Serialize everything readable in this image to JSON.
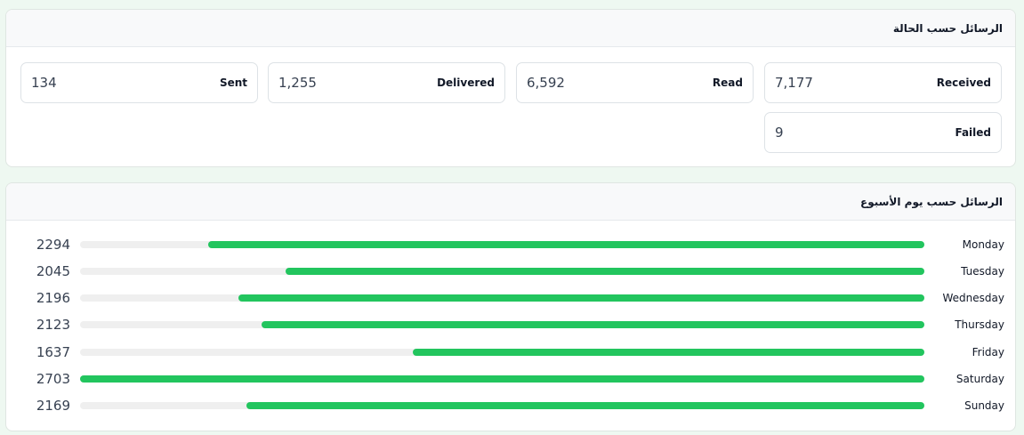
{
  "status_section": {
    "title": "الرسائل حسب الحالة",
    "items": [
      {
        "label": "Received",
        "value": "7,177"
      },
      {
        "label": "Read",
        "value": "6,592"
      },
      {
        "label": "Delivered",
        "value": "1,255"
      },
      {
        "label": "Sent",
        "value": "134"
      },
      {
        "label": "Failed",
        "value": "9"
      }
    ]
  },
  "weekday_section": {
    "title": "الرسائل حسب يوم الأسبوع",
    "max_value": 2703,
    "colors": {
      "fill": "#22c55e",
      "track": "#efefef"
    },
    "days": [
      {
        "label": "Monday",
        "value": 2294
      },
      {
        "label": "Tuesday",
        "value": 2045
      },
      {
        "label": "Wednesday",
        "value": 2196
      },
      {
        "label": "Thursday",
        "value": 2123
      },
      {
        "label": "Friday",
        "value": 1637
      },
      {
        "label": "Saturday",
        "value": 2703
      },
      {
        "label": "Sunday",
        "value": 2169
      }
    ]
  }
}
